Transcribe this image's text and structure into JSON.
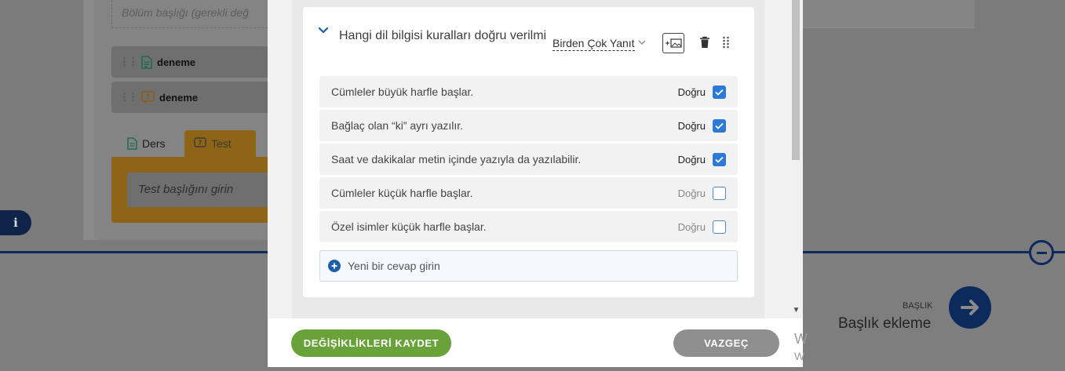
{
  "background": {
    "section_title_placeholder": "Bölüm başlığı (gerekli değ",
    "items": [
      {
        "label": "deneme",
        "icon": "document-icon"
      },
      {
        "label": "deneme",
        "icon": "question-icon"
      }
    ],
    "tabs": [
      {
        "label": "Ders",
        "icon": "document-icon"
      },
      {
        "label": "Test",
        "icon": "question-icon"
      }
    ],
    "test_title_placeholder": "Test başlığını girin",
    "info_label": "i",
    "baslik_caption": "BAŞLIK",
    "baslik_text": "Başlık ekleme",
    "partial_letters": [
      "W",
      "W"
    ]
  },
  "question": {
    "title": "Hangi dil bilgisi kuralları doğru verilmi",
    "type_label": "Birden Çok Yanıt",
    "answers": [
      {
        "text": "Cümleler büyük harfle başlar.",
        "correct_label": "Doğru",
        "checked": true
      },
      {
        "text": "Bağlaç olan “ki” ayrı yazılır.",
        "correct_label": "Doğru",
        "checked": true
      },
      {
        "text": "Saat ve dakikalar metin içinde yazıyla da yazılabilir.",
        "correct_label": "Doğru",
        "checked": true
      },
      {
        "text": "Cümleler küçük harfle başlar.",
        "correct_label": "Doğru",
        "checked": false
      },
      {
        "text": "Özel isimler küçük harfle başlar.",
        "correct_label": "Doğru",
        "checked": false
      }
    ],
    "new_answer_placeholder": "Yeni bir cevap girin"
  },
  "footer": {
    "save_label": "DEĞİŞİKLİKLERİ KAYDET",
    "cancel_label": "VAZGEÇ"
  },
  "colors": {
    "accent_blue": "#1f5fa8",
    "save_green": "#6aa23a",
    "cancel_gray": "#8f8f8f",
    "checkbox_blue": "#2d7ad6"
  }
}
